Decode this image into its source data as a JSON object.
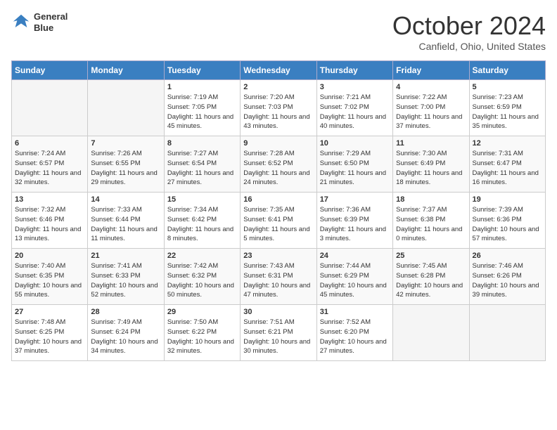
{
  "header": {
    "logo_line1": "General",
    "logo_line2": "Blue",
    "month_title": "October 2024",
    "location": "Canfield, Ohio, United States"
  },
  "days_of_week": [
    "Sunday",
    "Monday",
    "Tuesday",
    "Wednesday",
    "Thursday",
    "Friday",
    "Saturday"
  ],
  "weeks": [
    [
      {
        "day": "",
        "empty": true
      },
      {
        "day": "",
        "empty": true
      },
      {
        "day": "1",
        "sunrise": "7:19 AM",
        "sunset": "7:05 PM",
        "daylight": "11 hours and 45 minutes."
      },
      {
        "day": "2",
        "sunrise": "7:20 AM",
        "sunset": "7:03 PM",
        "daylight": "11 hours and 43 minutes."
      },
      {
        "day": "3",
        "sunrise": "7:21 AM",
        "sunset": "7:02 PM",
        "daylight": "11 hours and 40 minutes."
      },
      {
        "day": "4",
        "sunrise": "7:22 AM",
        "sunset": "7:00 PM",
        "daylight": "11 hours and 37 minutes."
      },
      {
        "day": "5",
        "sunrise": "7:23 AM",
        "sunset": "6:59 PM",
        "daylight": "11 hours and 35 minutes."
      }
    ],
    [
      {
        "day": "6",
        "sunrise": "7:24 AM",
        "sunset": "6:57 PM",
        "daylight": "11 hours and 32 minutes."
      },
      {
        "day": "7",
        "sunrise": "7:26 AM",
        "sunset": "6:55 PM",
        "daylight": "11 hours and 29 minutes."
      },
      {
        "day": "8",
        "sunrise": "7:27 AM",
        "sunset": "6:54 PM",
        "daylight": "11 hours and 27 minutes."
      },
      {
        "day": "9",
        "sunrise": "7:28 AM",
        "sunset": "6:52 PM",
        "daylight": "11 hours and 24 minutes."
      },
      {
        "day": "10",
        "sunrise": "7:29 AM",
        "sunset": "6:50 PM",
        "daylight": "11 hours and 21 minutes."
      },
      {
        "day": "11",
        "sunrise": "7:30 AM",
        "sunset": "6:49 PM",
        "daylight": "11 hours and 18 minutes."
      },
      {
        "day": "12",
        "sunrise": "7:31 AM",
        "sunset": "6:47 PM",
        "daylight": "11 hours and 16 minutes."
      }
    ],
    [
      {
        "day": "13",
        "sunrise": "7:32 AM",
        "sunset": "6:46 PM",
        "daylight": "11 hours and 13 minutes."
      },
      {
        "day": "14",
        "sunrise": "7:33 AM",
        "sunset": "6:44 PM",
        "daylight": "11 hours and 11 minutes."
      },
      {
        "day": "15",
        "sunrise": "7:34 AM",
        "sunset": "6:42 PM",
        "daylight": "11 hours and 8 minutes."
      },
      {
        "day": "16",
        "sunrise": "7:35 AM",
        "sunset": "6:41 PM",
        "daylight": "11 hours and 5 minutes."
      },
      {
        "day": "17",
        "sunrise": "7:36 AM",
        "sunset": "6:39 PM",
        "daylight": "11 hours and 3 minutes."
      },
      {
        "day": "18",
        "sunrise": "7:37 AM",
        "sunset": "6:38 PM",
        "daylight": "11 hours and 0 minutes."
      },
      {
        "day": "19",
        "sunrise": "7:39 AM",
        "sunset": "6:36 PM",
        "daylight": "10 hours and 57 minutes."
      }
    ],
    [
      {
        "day": "20",
        "sunrise": "7:40 AM",
        "sunset": "6:35 PM",
        "daylight": "10 hours and 55 minutes."
      },
      {
        "day": "21",
        "sunrise": "7:41 AM",
        "sunset": "6:33 PM",
        "daylight": "10 hours and 52 minutes."
      },
      {
        "day": "22",
        "sunrise": "7:42 AM",
        "sunset": "6:32 PM",
        "daylight": "10 hours and 50 minutes."
      },
      {
        "day": "23",
        "sunrise": "7:43 AM",
        "sunset": "6:31 PM",
        "daylight": "10 hours and 47 minutes."
      },
      {
        "day": "24",
        "sunrise": "7:44 AM",
        "sunset": "6:29 PM",
        "daylight": "10 hours and 45 minutes."
      },
      {
        "day": "25",
        "sunrise": "7:45 AM",
        "sunset": "6:28 PM",
        "daylight": "10 hours and 42 minutes."
      },
      {
        "day": "26",
        "sunrise": "7:46 AM",
        "sunset": "6:26 PM",
        "daylight": "10 hours and 39 minutes."
      }
    ],
    [
      {
        "day": "27",
        "sunrise": "7:48 AM",
        "sunset": "6:25 PM",
        "daylight": "10 hours and 37 minutes."
      },
      {
        "day": "28",
        "sunrise": "7:49 AM",
        "sunset": "6:24 PM",
        "daylight": "10 hours and 34 minutes."
      },
      {
        "day": "29",
        "sunrise": "7:50 AM",
        "sunset": "6:22 PM",
        "daylight": "10 hours and 32 minutes."
      },
      {
        "day": "30",
        "sunrise": "7:51 AM",
        "sunset": "6:21 PM",
        "daylight": "10 hours and 30 minutes."
      },
      {
        "day": "31",
        "sunrise": "7:52 AM",
        "sunset": "6:20 PM",
        "daylight": "10 hours and 27 minutes."
      },
      {
        "day": "",
        "empty": true
      },
      {
        "day": "",
        "empty": true
      }
    ]
  ],
  "labels": {
    "sunrise": "Sunrise:",
    "sunset": "Sunset:",
    "daylight": "Daylight:"
  }
}
